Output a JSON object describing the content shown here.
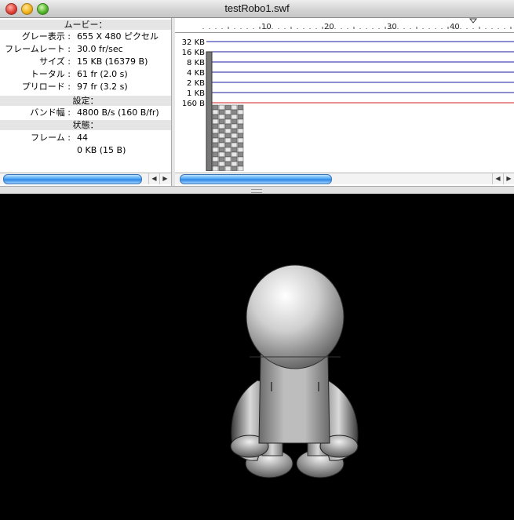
{
  "window": {
    "title": "testRobo1.swf"
  },
  "info": {
    "movie_header": "ムービー：",
    "rows_movie": [
      {
        "label": "グレー表示 :",
        "value": "655 X 480 ピクセル"
      },
      {
        "label": "フレームレート :",
        "value": "30.0 fr/sec"
      },
      {
        "label": "サイズ :",
        "value": "15 KB (16379 B)"
      },
      {
        "label": "トータル :",
        "value": "61 fr (2.0 s)"
      },
      {
        "label": "プリロード :",
        "value": "97 fr (3.2 s)"
      }
    ],
    "settings_header": "設定：",
    "rows_settings": [
      {
        "label": "バンド幅 :",
        "value": "4800 B/s (160 B/fr)"
      }
    ],
    "status_header": "状態：",
    "rows_status": [
      {
        "label": "フレーム :",
        "value": "44"
      },
      {
        "label": "",
        "value": "0 KB (15 B)"
      }
    ]
  },
  "ruler": {
    "ticks": [
      "10",
      "20",
      "30",
      "40"
    ],
    "playhead_frame": 44
  },
  "chart_data": {
    "type": "bar",
    "ylabels": [
      "32 KB",
      "16 KB",
      "8 KB",
      "4 KB",
      "2 KB",
      "1 KB",
      "160 B"
    ],
    "bandwidth_label": "160 B",
    "frames_shown": 6
  },
  "colors": {
    "grid_line": "#1a1aa0",
    "bandwidth_line": "#d02020",
    "scroll_thumb": "#4aa5f6"
  }
}
